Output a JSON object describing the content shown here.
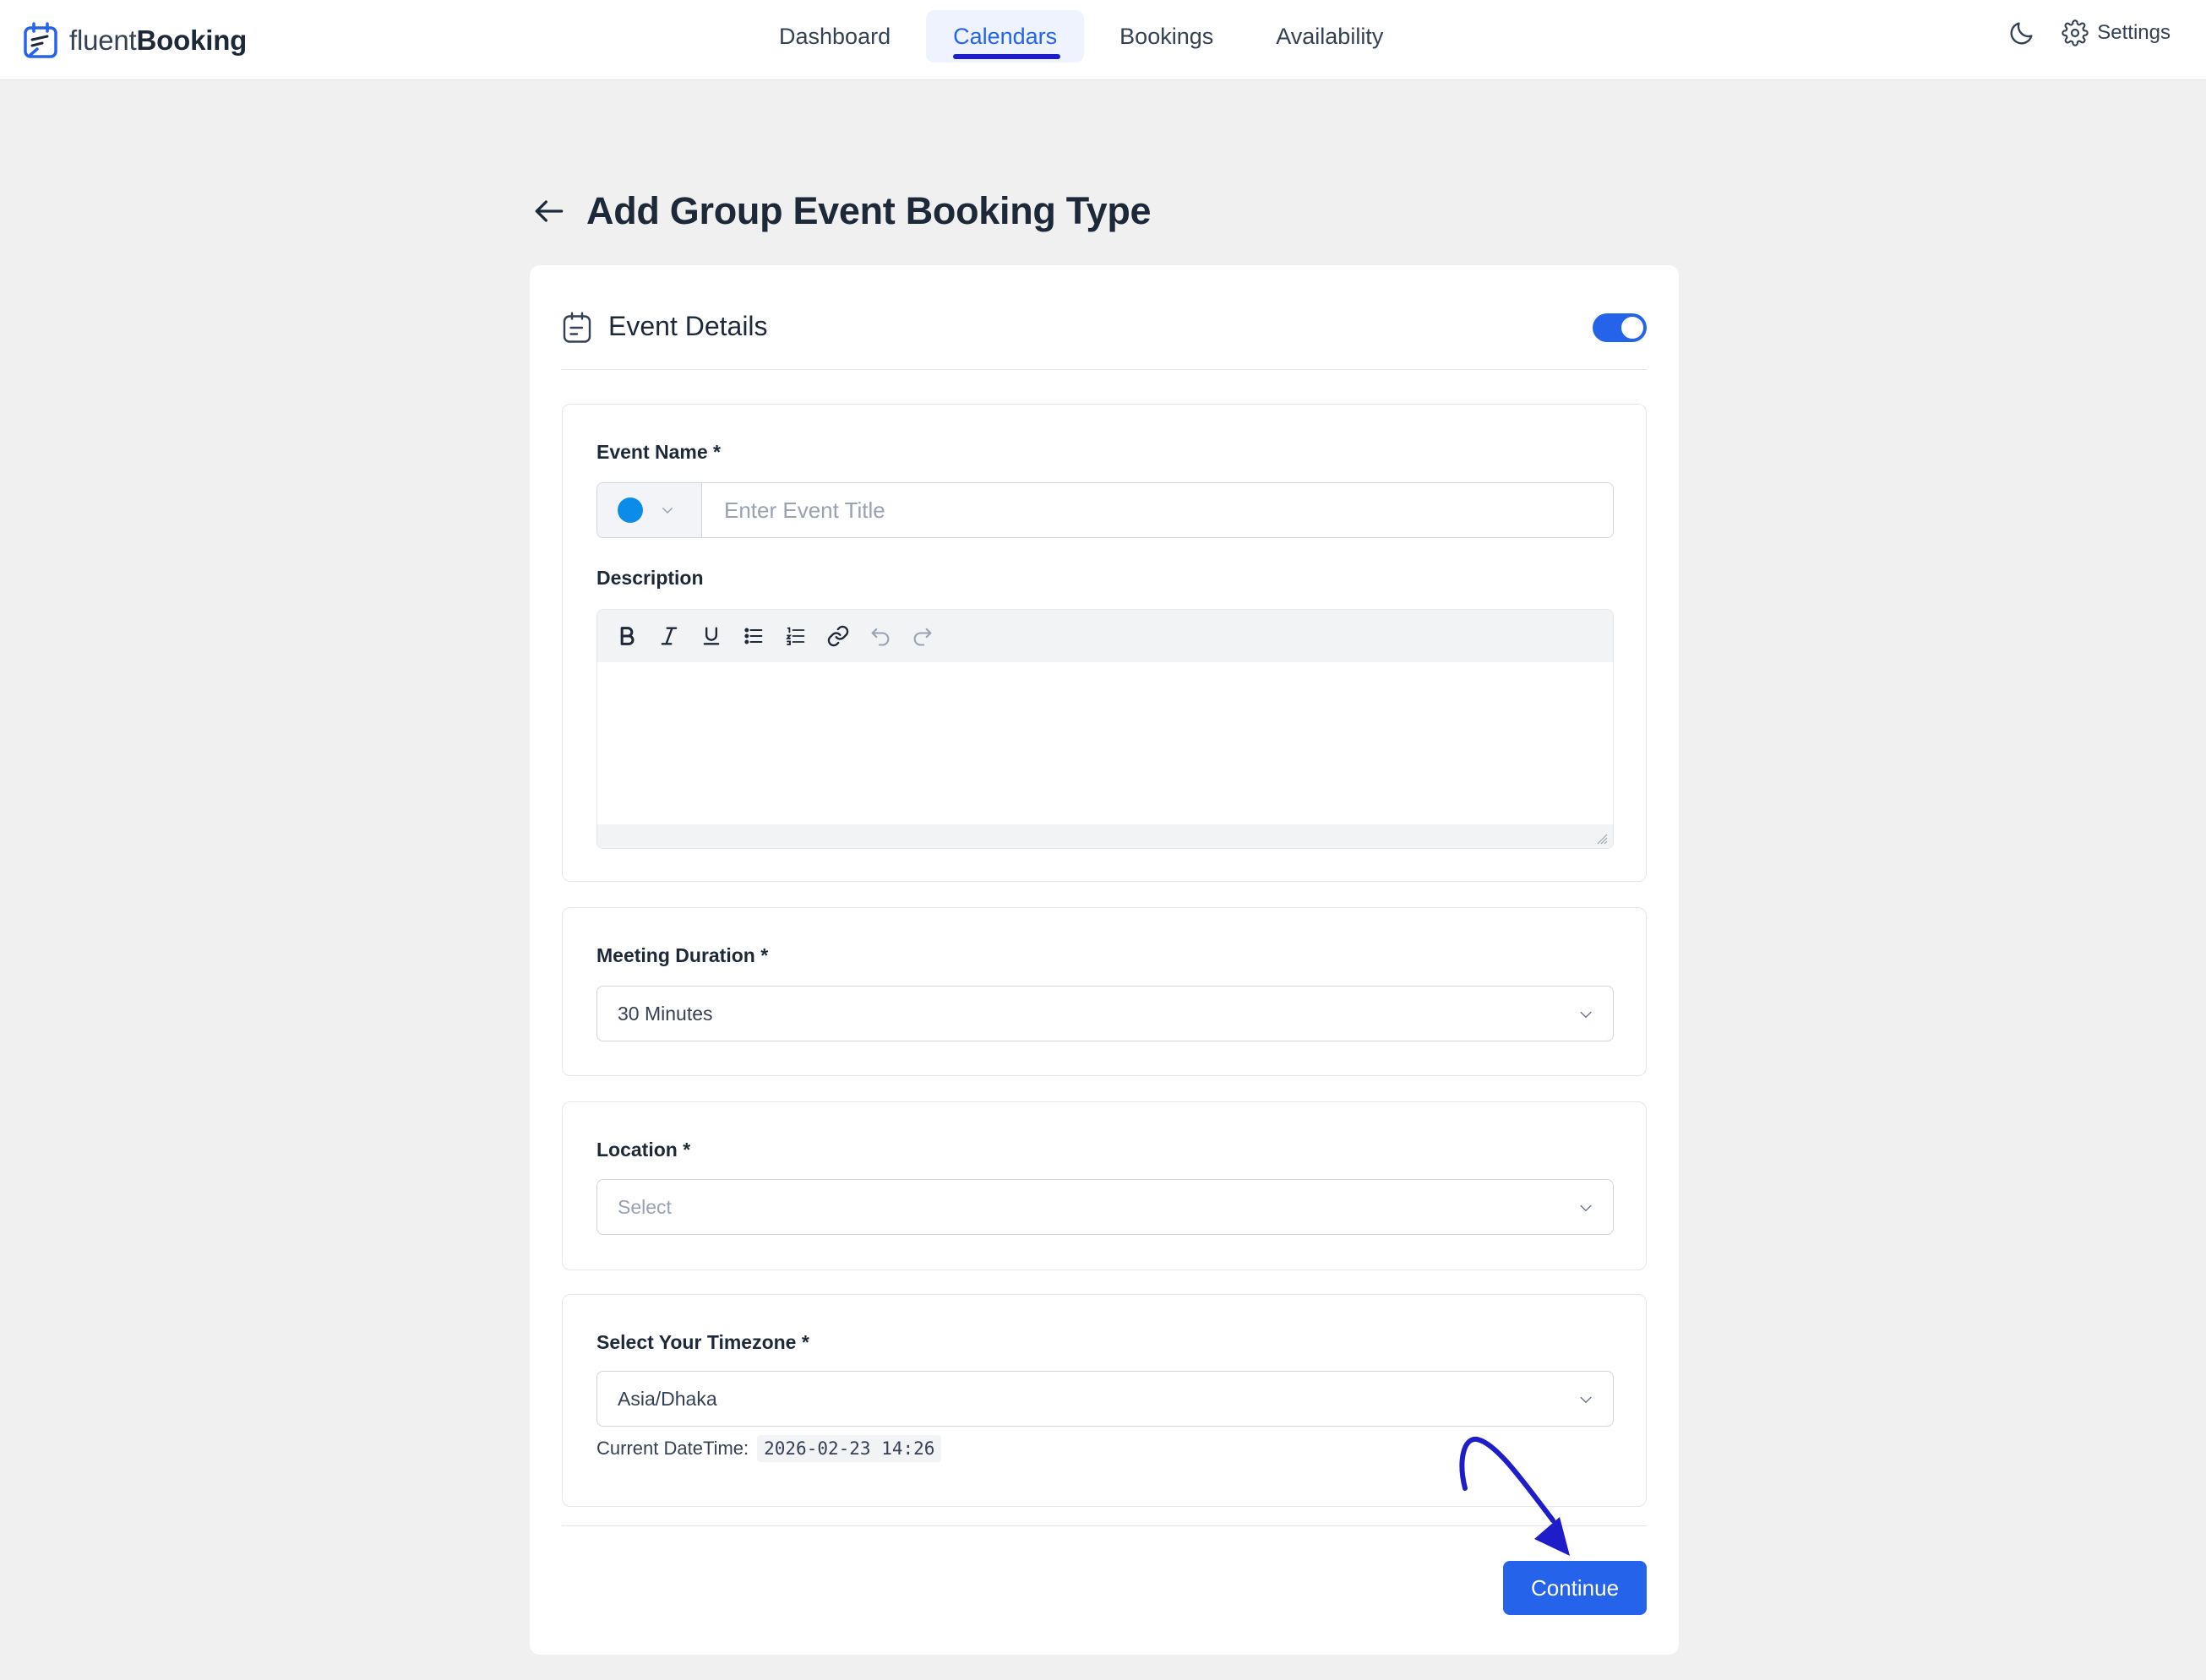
{
  "brand": {
    "name_light": "fluent",
    "name_bold": "Booking"
  },
  "nav": {
    "items": [
      {
        "label": "Dashboard"
      },
      {
        "label": "Calendars"
      },
      {
        "label": "Bookings"
      },
      {
        "label": "Availability"
      }
    ],
    "active_index": 1
  },
  "header": {
    "settings_label": "Settings"
  },
  "page": {
    "title": "Add Group Event Booking Type"
  },
  "card": {
    "title": "Event Details",
    "enabled": true
  },
  "event_name": {
    "label": "Event Name *",
    "placeholder": "Enter Event Title",
    "color": "#0c8ce9"
  },
  "description": {
    "label": "Description"
  },
  "meeting_duration": {
    "label": "Meeting Duration *",
    "value": "30 Minutes"
  },
  "location": {
    "label": "Location *",
    "placeholder": "Select"
  },
  "timezone": {
    "label": "Select Your Timezone *",
    "value": "Asia/Dhaka",
    "current_label": "Current DateTime:",
    "current_value": "2026-02-23 14:26"
  },
  "actions": {
    "continue_label": "Continue"
  },
  "colors": {
    "primary": "#2563eb",
    "annotation": "#1f1cc9"
  }
}
